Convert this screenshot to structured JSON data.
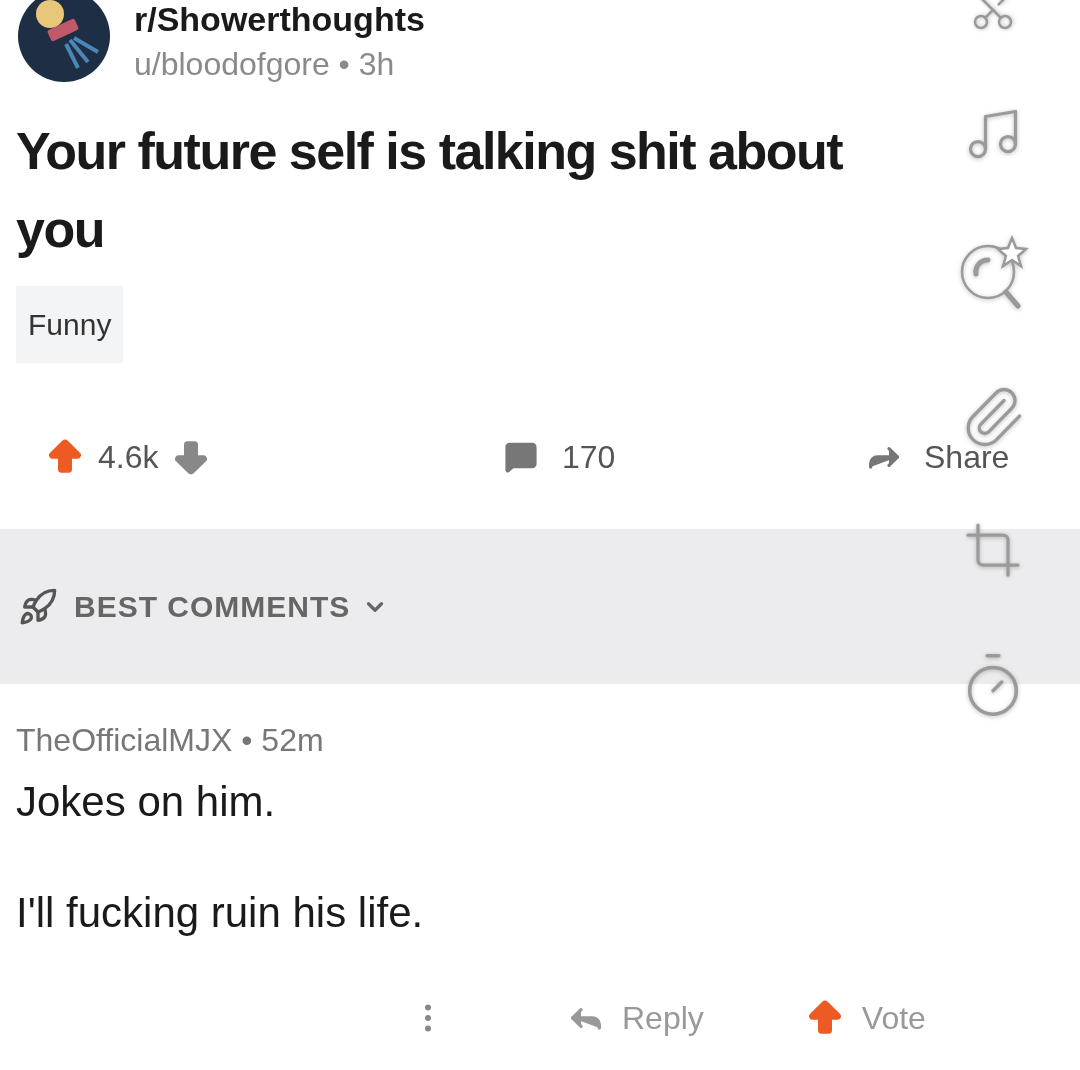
{
  "post": {
    "subreddit": "r/Showerthoughts",
    "author": "u/bloodofgore",
    "separator": "•",
    "age": "3h",
    "title": "Your future self is talking shit about you",
    "flair": "Funny"
  },
  "actions": {
    "score": "4.6k",
    "comments": "170",
    "share": "Share"
  },
  "sort": {
    "label": "BEST COMMENTS"
  },
  "comment": {
    "author": "TheOfficialMJX",
    "separator": "•",
    "age": "52m",
    "paragraphs": [
      "Jokes on him.",
      "I'll fucking ruin his life."
    ]
  },
  "comment_actions": {
    "reply": "Reply",
    "vote": "Vote"
  }
}
